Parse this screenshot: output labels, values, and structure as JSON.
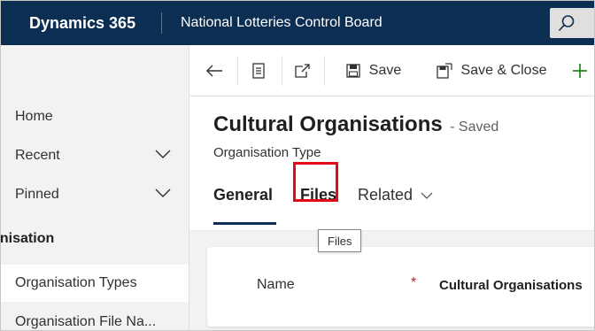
{
  "navbar": {
    "app_name": "Dynamics 365",
    "org_name": "National Lotteries Control Board",
    "icons": {
      "search": "search-icon"
    }
  },
  "sidebar": {
    "items": [
      {
        "label": "Home"
      },
      {
        "label": "Recent",
        "icon": "chevron-down-icon"
      },
      {
        "label": "Pinned",
        "icon": "chevron-down-icon"
      }
    ],
    "group_label": "anisation",
    "sub_items": [
      {
        "label": "Organisation Types",
        "active": true
      },
      {
        "label": "Organisation File Na..."
      }
    ]
  },
  "command_bar": {
    "back_icon": "back-arrow-icon",
    "form_icon": "form-icon",
    "popout_icon": "open-new-window-icon",
    "save_label": "Save",
    "save_close_label": "Save & Close",
    "new_icon": "plus-icon"
  },
  "record": {
    "title": "Cultural Organisations",
    "status": "- Saved",
    "entity": "Organisation Type"
  },
  "tabs": [
    {
      "label": "General",
      "selected": true
    },
    {
      "label": "Files"
    },
    {
      "label": "Related",
      "icon": "chevron-down-icon"
    }
  ],
  "tooltip": {
    "text": "Files"
  },
  "form": {
    "name_label": "Name",
    "required_marker": "*",
    "name_value": "Cultural Organisations"
  },
  "colors": {
    "navbar": "#0b2e52",
    "accent": "#0b2e52",
    "highlight": "#e20a16",
    "add": "#107c10",
    "required": "#a4262c"
  }
}
